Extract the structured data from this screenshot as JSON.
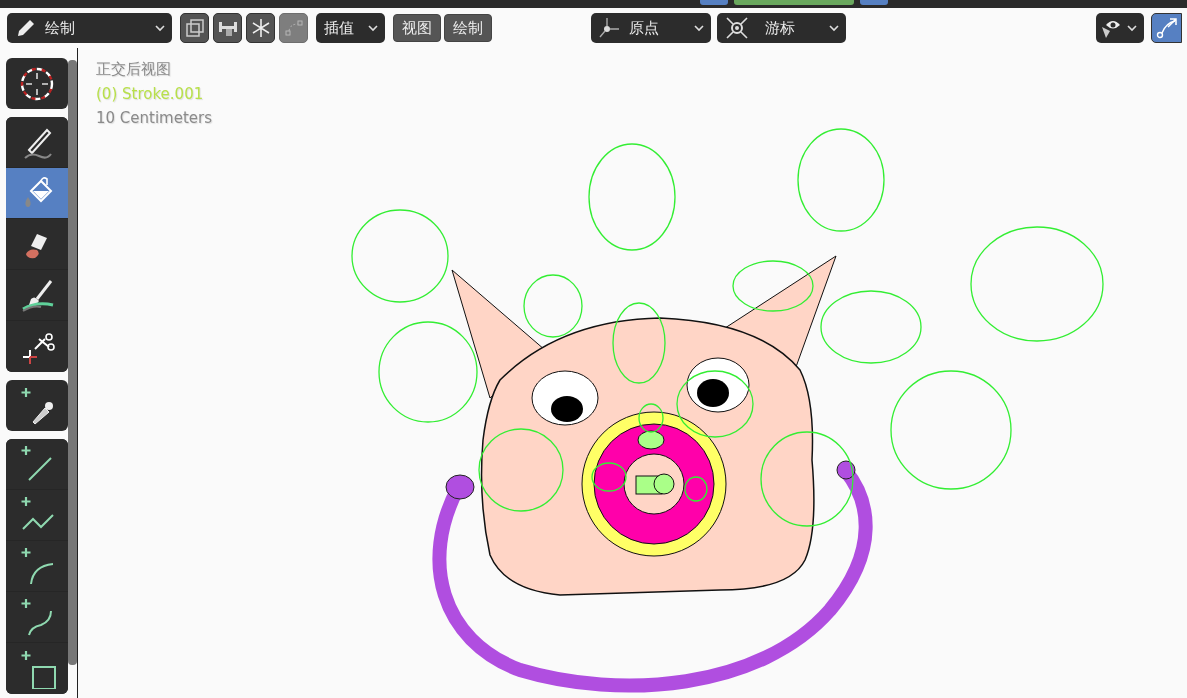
{
  "header": {
    "mode": {
      "label": "绘制"
    },
    "icon_buttons": [
      {
        "kind": "multiframe",
        "disabled": false
      },
      {
        "kind": "weight",
        "disabled": false
      },
      {
        "kind": "freeze",
        "disabled": false
      },
      {
        "kind": "curve",
        "disabled": true
      }
    ],
    "interpolate": {
      "label": "插值"
    },
    "menus": [
      {
        "label": "视图"
      },
      {
        "label": "绘制"
      }
    ],
    "origin": {
      "label": "原点"
    },
    "cursor": {
      "label": "游标"
    },
    "gizmo_toggle": {
      "on": true
    }
  },
  "toolbar": {
    "groups": [
      [
        {
          "kind": "cursor",
          "selected": false
        }
      ],
      [
        {
          "kind": "draw",
          "selected": false
        },
        {
          "kind": "fill",
          "selected": true
        },
        {
          "kind": "erase",
          "selected": false
        },
        {
          "kind": "tint",
          "selected": false
        },
        {
          "kind": "cutter",
          "selected": false
        }
      ],
      [
        {
          "kind": "eyedropper",
          "selected": false
        }
      ],
      [
        {
          "kind": "line",
          "selected": false
        },
        {
          "kind": "polyline",
          "selected": false
        },
        {
          "kind": "arc",
          "selected": false
        },
        {
          "kind": "curve",
          "selected": false
        },
        {
          "kind": "box",
          "selected": false
        }
      ]
    ]
  },
  "viewport": {
    "view_name": "正交后视图",
    "object_name": "(0) Stroke.001",
    "scale": "10 Centimeters"
  }
}
